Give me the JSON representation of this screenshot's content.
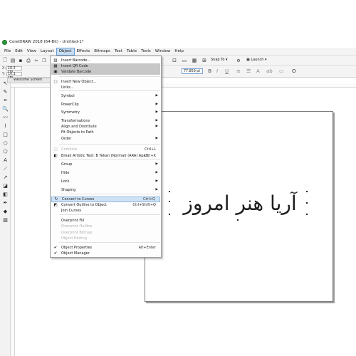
{
  "window": {
    "title": "CorelDRAW 2018 (64-Bit) - Untitled-1*"
  },
  "menubar": {
    "items": [
      "File",
      "Edit",
      "View",
      "Layout",
      "Object",
      "Effects",
      "Bitmaps",
      "Text",
      "Table",
      "Tools",
      "Window",
      "Help"
    ],
    "active": "Object"
  },
  "toolbar": {
    "snap_to_label": "Snap To",
    "launch_label": "Launch"
  },
  "propbar": {
    "x_label": "X:",
    "x_value": "10.3 cm",
    "y_label": "Y:",
    "y_value": "10.1 cm",
    "font_size": "77.859 pt",
    "format_glyphs": [
      "B",
      "I",
      "U"
    ]
  },
  "tab": {
    "label": "Welcome Screen"
  },
  "canvas": {
    "text": "آریا هنر امروز"
  },
  "object_menu": {
    "items": [
      {
        "icon": "barcode-icon",
        "glyph": "▥",
        "label": "Insert Barcode...",
        "shortcut": "",
        "submenu": false,
        "disabled": false,
        "state": "normal"
      },
      {
        "icon": "qr-code-icon",
        "glyph": "▦",
        "label": "Insert QR Code",
        "shortcut": "",
        "submenu": false,
        "disabled": false,
        "state": "hover"
      },
      {
        "icon": "validate-barcode-icon",
        "glyph": "▣",
        "label": "Validate Barcode",
        "shortcut": "",
        "submenu": false,
        "disabled": false,
        "state": "hover"
      },
      {
        "icon": "insert-object-icon",
        "glyph": "▢",
        "label": "Insert New Object...",
        "shortcut": "",
        "submenu": false,
        "disabled": false,
        "state": "normal"
      },
      {
        "icon": "links-icon",
        "glyph": "",
        "label": "Links...",
        "shortcut": "",
        "submenu": false,
        "disabled": false,
        "state": "normal"
      },
      {
        "icon": "symbol-icon",
        "glyph": "",
        "label": "Symbol",
        "shortcut": "",
        "submenu": true,
        "disabled": false,
        "state": "normal"
      },
      {
        "icon": "powerclip-icon",
        "glyph": "",
        "label": "PowerClip",
        "shortcut": "",
        "submenu": true,
        "disabled": false,
        "state": "normal"
      },
      {
        "icon": "symmetry-icon",
        "glyph": "",
        "label": "Symmetry",
        "shortcut": "",
        "submenu": true,
        "disabled": false,
        "state": "normal"
      },
      {
        "icon": "transformations-icon",
        "glyph": "",
        "label": "Transformations",
        "shortcut": "",
        "submenu": true,
        "disabled": false,
        "state": "normal"
      },
      {
        "icon": "align-distribute-icon",
        "glyph": "",
        "label": "Align and Distribute",
        "shortcut": "",
        "submenu": true,
        "disabled": false,
        "state": "normal"
      },
      {
        "icon": "fit-objects-icon",
        "glyph": "",
        "label": "Fit Objects to Path",
        "shortcut": "",
        "submenu": false,
        "disabled": false,
        "state": "normal"
      },
      {
        "icon": "order-icon",
        "glyph": "",
        "label": "Order",
        "shortcut": "",
        "submenu": true,
        "disabled": false,
        "state": "normal"
      },
      {
        "icon": "combine-icon",
        "glyph": "◫",
        "label": "Combine",
        "shortcut": "Ctrl+L",
        "submenu": false,
        "disabled": true,
        "state": "normal"
      },
      {
        "icon": "break-apart-icon",
        "glyph": "◧",
        "label": "Break Artistic Text: B Yekan (Normal) (ARA) Apart",
        "shortcut": "Ctrl+K",
        "submenu": false,
        "disabled": false,
        "state": "normal"
      },
      {
        "icon": "group-icon",
        "glyph": "",
        "label": "Group",
        "shortcut": "",
        "submenu": true,
        "disabled": false,
        "state": "normal"
      },
      {
        "icon": "hide-icon",
        "glyph": "",
        "label": "Hide",
        "shortcut": "",
        "submenu": true,
        "disabled": false,
        "state": "normal"
      },
      {
        "icon": "lock-icon",
        "glyph": "",
        "label": "Lock",
        "shortcut": "",
        "submenu": true,
        "disabled": false,
        "state": "normal"
      },
      {
        "icon": "shaping-icon",
        "glyph": "",
        "label": "Shaping",
        "shortcut": "",
        "submenu": true,
        "disabled": false,
        "state": "normal"
      },
      {
        "icon": "convert-to-curves-icon",
        "glyph": "↻",
        "label": "Convert to Curves",
        "shortcut": "Ctrl+Q",
        "submenu": false,
        "disabled": false,
        "state": "selected"
      },
      {
        "icon": "convert-outline-icon",
        "glyph": "◩",
        "label": "Convert Outline to Object",
        "shortcut": "Ctrl+Shift+Q",
        "submenu": false,
        "disabled": false,
        "state": "normal"
      },
      {
        "icon": "join-curves-icon",
        "glyph": "",
        "label": "Join Curves",
        "shortcut": "",
        "submenu": false,
        "disabled": false,
        "state": "normal"
      },
      {
        "icon": "overprint-fill-icon",
        "glyph": "",
        "label": "Overprint Fill",
        "shortcut": "",
        "submenu": false,
        "disabled": false,
        "state": "normal"
      },
      {
        "icon": "overprint-outline-icon",
        "glyph": "",
        "label": "Overprint Outline",
        "shortcut": "",
        "submenu": false,
        "disabled": true,
        "state": "normal"
      },
      {
        "icon": "overprint-bitmap-icon",
        "glyph": "",
        "label": "Overprint Bitmap",
        "shortcut": "",
        "submenu": false,
        "disabled": true,
        "state": "normal"
      },
      {
        "icon": "object-hinting-icon",
        "glyph": "",
        "label": "Object Hinting",
        "shortcut": "",
        "submenu": false,
        "disabled": true,
        "state": "normal"
      },
      {
        "icon": "check-icon",
        "glyph": "✔",
        "label": "Object Properties",
        "shortcut": "Alt+Enter",
        "submenu": false,
        "disabled": false,
        "state": "normal"
      },
      {
        "icon": "check-icon",
        "glyph": "✔",
        "label": "Object Manager",
        "shortcut": "",
        "submenu": false,
        "disabled": false,
        "state": "normal"
      }
    ]
  },
  "toolbox": {
    "tools": [
      "pick-tool-icon",
      "shape-tool-icon",
      "crop-tool-icon",
      "zoom-tool-icon",
      "freehand-tool-icon",
      "artistic-media-icon",
      "rectangle-tool-icon",
      "ellipse-tool-icon",
      "polygon-tool-icon",
      "text-tool-icon",
      "parallel-dimension-icon",
      "connector-tool-icon",
      "drop-shadow-icon",
      "transparency-icon",
      "eyedropper-icon",
      "interactive-fill-icon",
      "smart-fill-icon"
    ]
  },
  "colors": {
    "accent": "#c5dcf2",
    "highlight": "#cfe3f7",
    "menu_hover": "#c7c7c7",
    "disabled_text": "#b0b0b0"
  }
}
